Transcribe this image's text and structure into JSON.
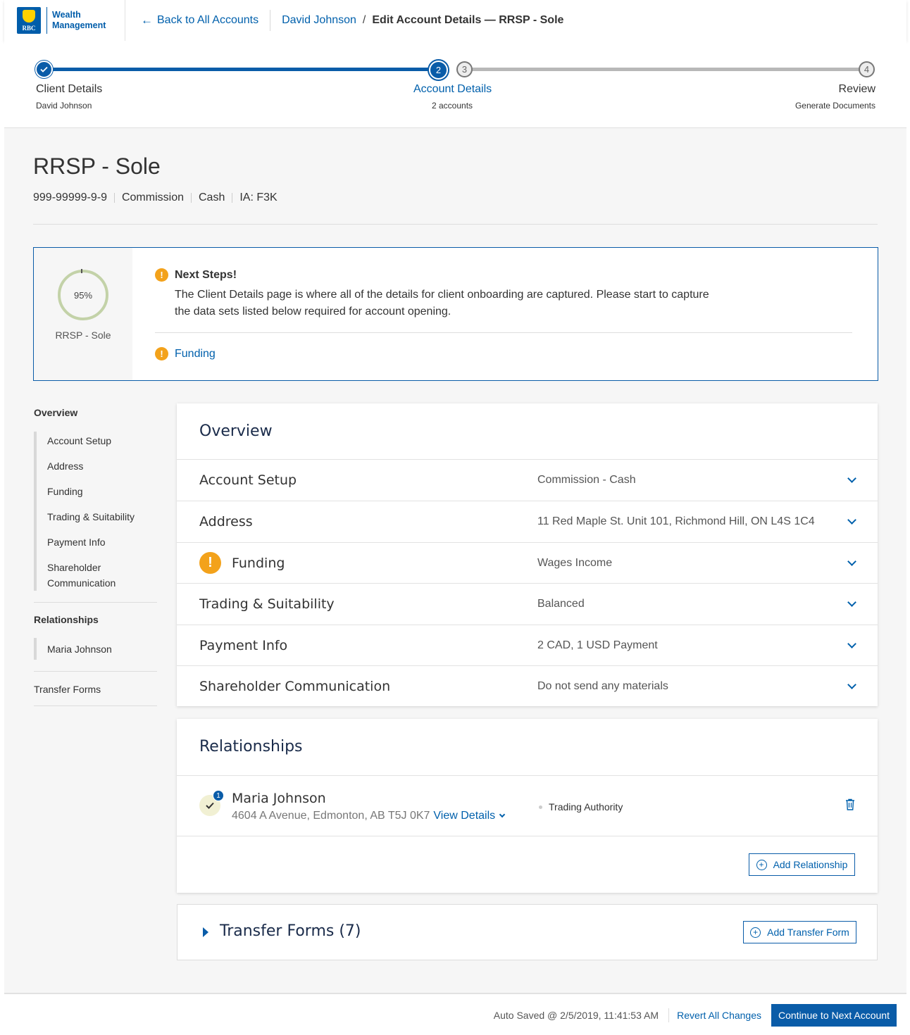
{
  "header": {
    "logo_line1": "Wealth",
    "logo_line2": "Management",
    "logo_mark": "RBC",
    "back_label": "Back to All Accounts",
    "crumb_client": "David Johnson",
    "crumb_sep": "/",
    "crumb_current": "Edit Account Details — RRSP - Sole"
  },
  "stepper": {
    "steps": [
      {
        "num": "",
        "label": "Client Details",
        "sub": "David Johnson",
        "state": "done"
      },
      {
        "num": "2",
        "label": "Account Details",
        "sub": "2 accounts",
        "state": "current"
      },
      {
        "num": "3",
        "label": "",
        "sub": "",
        "state": "todo"
      },
      {
        "num": "4",
        "label": "Review",
        "sub": "Generate Documents",
        "state": "todo"
      }
    ]
  },
  "account": {
    "title": "RRSP - Sole",
    "number": "999-99999-9-9",
    "fee_type": "Commission",
    "account_type": "Cash",
    "ia": "IA: F3K"
  },
  "next_steps": {
    "progress_percent": 95,
    "progress_label": "95%",
    "account_label": "RRSP - Sole",
    "title": "Next Steps!",
    "body": "The Client Details page is where all of the details for client onboarding are captured. Please start to capture the data sets listed below required for account opening.",
    "items": [
      "Funding"
    ]
  },
  "side_nav": {
    "overview_head": "Overview",
    "overview_items": [
      "Account Setup",
      "Address",
      "Funding",
      "Trading & Suitability",
      "Payment Info",
      "Shareholder Communication"
    ],
    "relationships_head": "Relationships",
    "relationship_items": [
      "Maria Johnson"
    ],
    "transfer_forms": "Transfer Forms"
  },
  "overview": {
    "title": "Overview",
    "rows": [
      {
        "label": "Account Setup",
        "value": "Commission - Cash",
        "warning": false
      },
      {
        "label": "Address",
        "value": "11 Red Maple St. Unit 101, Richmond Hill, ON L4S 1C4",
        "warning": false
      },
      {
        "label": "Funding",
        "value": "Wages Income",
        "warning": true
      },
      {
        "label": "Trading & Suitability",
        "value": "Balanced",
        "warning": false
      },
      {
        "label": "Payment Info",
        "value": "2 CAD, 1 USD Payment",
        "warning": false
      },
      {
        "label": "Shareholder Communication",
        "value": "Do not send any materials",
        "warning": false
      }
    ]
  },
  "relationships": {
    "title": "Relationships",
    "people": [
      {
        "name": "Maria Johnson",
        "address": "4604 A Avenue, Edmonton, AB T5J 0K7",
        "view_label": "View Details",
        "role": "Trading Authority",
        "badge": "1"
      }
    ],
    "add_label": "Add Relationship"
  },
  "transfer_forms": {
    "title": "Transfer Forms (7)",
    "add_label": "Add Transfer Form"
  },
  "footer": {
    "autosave": "Auto Saved @ 2/5/2019, 11:41:53 AM",
    "revert_label": "Revert All Changes",
    "continue_label": "Continue to Next Account"
  },
  "colors": {
    "brand_blue": "#0a5ca8",
    "link_blue": "#0060ac",
    "warning": "#f3a21b",
    "progress_ring": "#c3d2a8"
  },
  "icons": {
    "back": "arrow-left-icon",
    "step_done": "check-icon",
    "warning": "exclamation-circle-icon",
    "expand": "chevron-down-icon",
    "delete": "trash-icon",
    "add": "plus-circle-icon",
    "collapse": "caret-right-icon"
  }
}
